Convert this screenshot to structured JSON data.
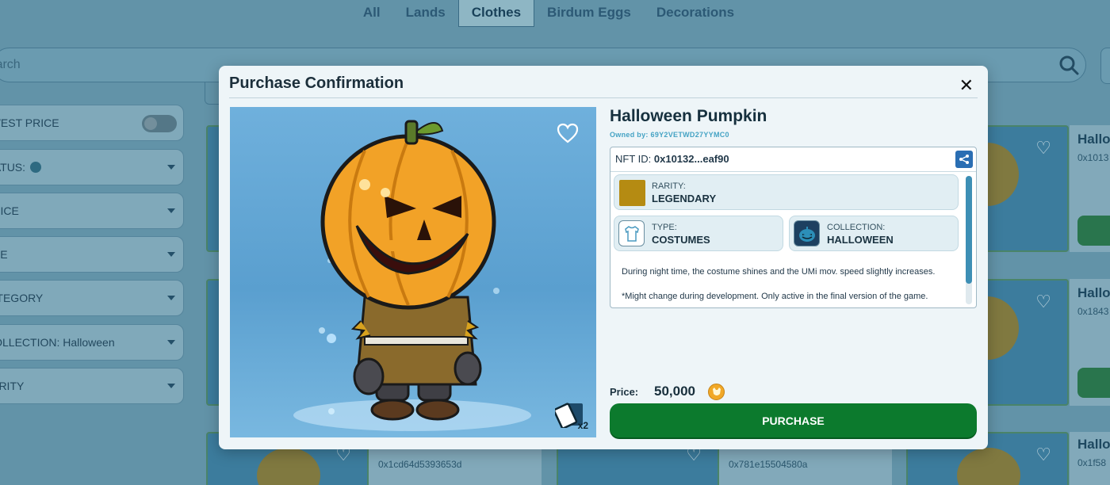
{
  "nav": {
    "tabs": [
      "All",
      "Lands",
      "Clothes",
      "Birdum Eggs",
      "Decorations"
    ],
    "active_tab": "Clothes"
  },
  "search": {
    "placeholder": "Search"
  },
  "filters": {
    "lowest_price": "LOWEST PRICE",
    "status": "STATUS:",
    "price": "PRICE",
    "type": "TYPE",
    "category": "CATEGORY",
    "collection": "COLLECTION: Halloween",
    "rarity": "RARITY"
  },
  "background_cards": {
    "right_titles": [
      "Hallo",
      "Hallo",
      "Hallo"
    ],
    "right_ids": [
      "0x1013",
      "0x1843",
      "0x1f58"
    ],
    "bottom_ids": [
      "0x1cd64d5393653d",
      "0x781e15504580a"
    ]
  },
  "modal": {
    "title": "Purchase Confirmation",
    "close_icon": "close-icon",
    "item_name": "Halloween Pumpkin",
    "owner_label": "Owned by:",
    "owner_value": "69Y2VETWD27YYMC0",
    "nft_id_label": "NFT ID:",
    "nft_id_value": "0x10132...eaf90",
    "rarity_label": "RARITY:",
    "rarity_value": "LEGENDARY",
    "rarity_color": "#b58b12",
    "type_label": "TYPE:",
    "type_value": "COSTUMES",
    "collection_label": "COLLECTION:",
    "collection_value": "HALLOWEEN",
    "description_1": "During night time, the costume shines and the UMi mov. speed slightly increases.",
    "description_2": "*Might change during development. Only active in the final version of the game.",
    "quantity": "x2",
    "price_label": "Price:",
    "price_value": "50,000",
    "purchase_label": "PURCHASE",
    "accent_color": "#0c7a2d"
  }
}
